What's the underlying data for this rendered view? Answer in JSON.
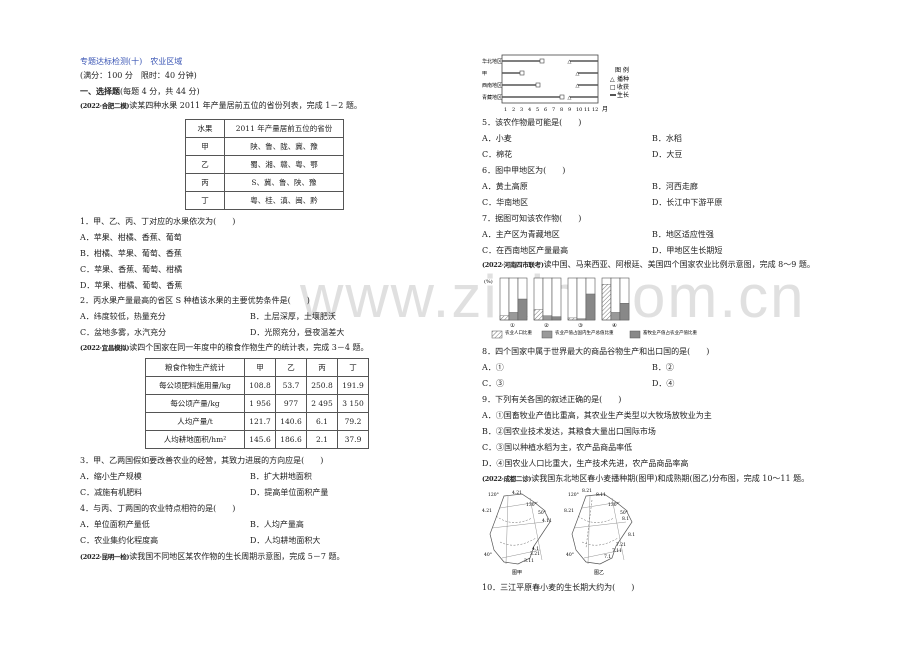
{
  "header": {
    "title": "专题达标检测(十)　农业区域",
    "meta": "(满分：100 分　限时：40 分钟)",
    "section": "一、选择题",
    "section_note": "(每题 4 分，共 44 分)"
  },
  "group1": {
    "source": "(2022·合肥二模)",
    "intro": "读某四种水果 2011 年产量居前五位的省份列表，完成 1－2 题。",
    "table": {
      "headers": [
        "水果",
        "2011 年产量居前五位的省份"
      ],
      "rows": [
        [
          "甲",
          "陕、鲁、陇、冀、豫"
        ],
        [
          "乙",
          "蜀、湘、赣、粤、鄂"
        ],
        [
          "丙",
          "S、冀、鲁、陕、豫"
        ],
        [
          "丁",
          "粤、桂、滇、闽、黔"
        ]
      ]
    },
    "q1": {
      "stem": "1．甲、乙、丙、丁对应的水果依次为(　　)",
      "options": [
        "A．苹果、柑橘、香蕉、葡萄",
        "B．柑橘、苹果、葡萄、香蕉",
        "C．苹果、香蕉、葡萄、柑橘",
        "D．苹果、柑橘、葡萄、香蕉"
      ]
    },
    "q2": {
      "stem": "2．丙水果产量最高的省区 S 种植该水果的主要优势条件是(　　)",
      "options": [
        "A．纬度较低，热量充分",
        "B．土层深厚，土壤肥沃",
        "C．盆地多雾，水汽充分",
        "D．光照充分，昼夜温差大"
      ]
    }
  },
  "group2": {
    "source": "(2022·宜昌模拟)",
    "intro": "读四个国家在同一年度中的粮食作物生产的统计表，完成 3－4 题。",
    "table": {
      "headers": [
        "粮食作物生产统计",
        "甲",
        "乙",
        "丙",
        "丁"
      ],
      "rows": [
        [
          "每公顷肥料施用量/kg",
          "108.8",
          "53.7",
          "250.8",
          "191.9"
        ],
        [
          "每公顷产量/kg",
          "1 956",
          "977",
          "2 495",
          "3 150"
        ],
        [
          "人均产量/t",
          "121.7",
          "140.6",
          "6.1",
          "79.2"
        ],
        [
          "人均耕地面积/hm²",
          "145.6",
          "186.6",
          "2.1",
          "37.9"
        ]
      ]
    },
    "q3": {
      "stem": "3．甲、乙两国假如要改善农业的经营，其致力进展的方向应是(　　)",
      "options": [
        "A．缩小生产规模",
        "B．扩大耕地面积",
        "C．减施有机肥料",
        "D．提高单位面积产量"
      ]
    },
    "q4": {
      "stem": "4．与丙、丁两国的农业特点相符的是(　　)",
      "options": [
        "A．单位面积产量低",
        "B．人均产量高",
        "C．农业集约化程度高",
        "D．人均耕地面积大"
      ]
    }
  },
  "group3": {
    "source": "(2022·昆明一检)",
    "intro": "读我国不同地区某农作物的生长周期示意图，完成 5－7 题。",
    "chart": {
      "regions": [
        "华北地区",
        "甲",
        "西南地区",
        "青藏地区"
      ],
      "months": [
        "1",
        "2",
        "3",
        "4",
        "5",
        "6",
        "7",
        "8",
        "9",
        "10",
        "11",
        "12"
      ],
      "month_unit": "月",
      "legend_title": "图 例",
      "legend": [
        "播种",
        "收获",
        "生长"
      ]
    },
    "q5": {
      "stem": "5．该农作物最可能是(　　)",
      "options": [
        "A．小麦",
        "B．水稻",
        "C．棉花",
        "D．大豆"
      ]
    },
    "q6": {
      "stem": "6．图中甲地区为(　　)",
      "options": [
        "A．黄土高原",
        "B．河西走廊",
        "C．华南地区",
        "D．长江中下游平原"
      ]
    },
    "q7": {
      "stem": "7．据图可知该农作物(　　)",
      "options": [
        "A．主产区为青藏地区",
        "B．地区适应性强",
        "C．在西南地区产量最高",
        "D．甲地区生长期短"
      ]
    }
  },
  "group4": {
    "source": "(2022·河南四市联考)",
    "intro": "读中国、马来西亚、阿根廷、美国四个国家农业比例示意图，完成 8～9 题。",
    "chart": {
      "unit": "(%)",
      "countries": [
        "①",
        "②",
        "③",
        "④"
      ],
      "legend": [
        "农业人口比重",
        "农业产值占国内生产总值比重",
        "畜牧业产值占农业产值比重"
      ]
    },
    "q8": {
      "stem": "8．四个国家中属于世界最大的商品谷物生产和出口国的是(　　)",
      "options": [
        "A．①",
        "B．②",
        "C．③",
        "D．④"
      ]
    },
    "q9": {
      "stem": "9．下列有关各国的叙述正确的是(　　)",
      "options": [
        "A．①国畜牧业产值比重高，其农业生产类型以大牧场放牧业为主",
        "B．②国农业技术发达，其粮食大量出口国际市场",
        "C．③国以种植水稻为主，农产品商品率低",
        "D．④国农业人口比重大，生产技术先进，农产品商品率高"
      ]
    }
  },
  "group5": {
    "source": "(2022·成都二诊)",
    "intro": "读我国东北地区春小麦播种期(图甲)和成熟期(图乙)分布图，完成 10～11 题。",
    "map_a": {
      "caption": "图甲",
      "labels": [
        "120°",
        "4.21",
        "4.21",
        "130°",
        "50°",
        "4.11",
        "4.1",
        "3.21",
        "3.11",
        "40°"
      ]
    },
    "map_b": {
      "caption": "图乙",
      "labels": [
        "120°",
        "8.21",
        "8.11",
        "8.21",
        "130°",
        "50°",
        "8.1",
        "8.1",
        "7.21",
        "7.11",
        "7.1",
        "40°"
      ]
    },
    "q10": {
      "stem": "10．三江平原春小麦的生长期大约为(　　)"
    }
  },
  "chart_data": [
    {
      "type": "bar",
      "title": "我国不同地区某农作物的生长周期示意图",
      "xlabel": "月",
      "categories": [
        "华北地区",
        "甲",
        "西南地区",
        "青藏地区"
      ],
      "x_ticks": [
        1,
        2,
        3,
        4,
        5,
        6,
        7,
        8,
        9,
        10,
        11,
        12
      ],
      "series": [
        {
          "name": "播种",
          "values": [
            9,
            10,
            10,
            9
          ]
        },
        {
          "name": "收获",
          "values": [
            5.5,
            3,
            5,
            8
          ]
        }
      ],
      "legend": [
        "播种",
        "收获",
        "生长"
      ],
      "legend_position": "right"
    },
    {
      "type": "bar",
      "title": "四个国家农业比例示意图",
      "ylabel": "(%)",
      "categories": [
        "①",
        "②",
        "③",
        "④"
      ],
      "series": [
        {
          "name": "农业人口比重",
          "values": [
            10,
            25,
            5,
            85
          ]
        },
        {
          "name": "农业产值占国内生产总值比重",
          "values": [
            18,
            10,
            3,
            18
          ]
        },
        {
          "name": "畜牧业产值占农业产值比重",
          "values": [
            50,
            8,
            62,
            40
          ]
        }
      ],
      "ylim": [
        0,
        100
      ],
      "legend_position": "bottom"
    }
  ]
}
